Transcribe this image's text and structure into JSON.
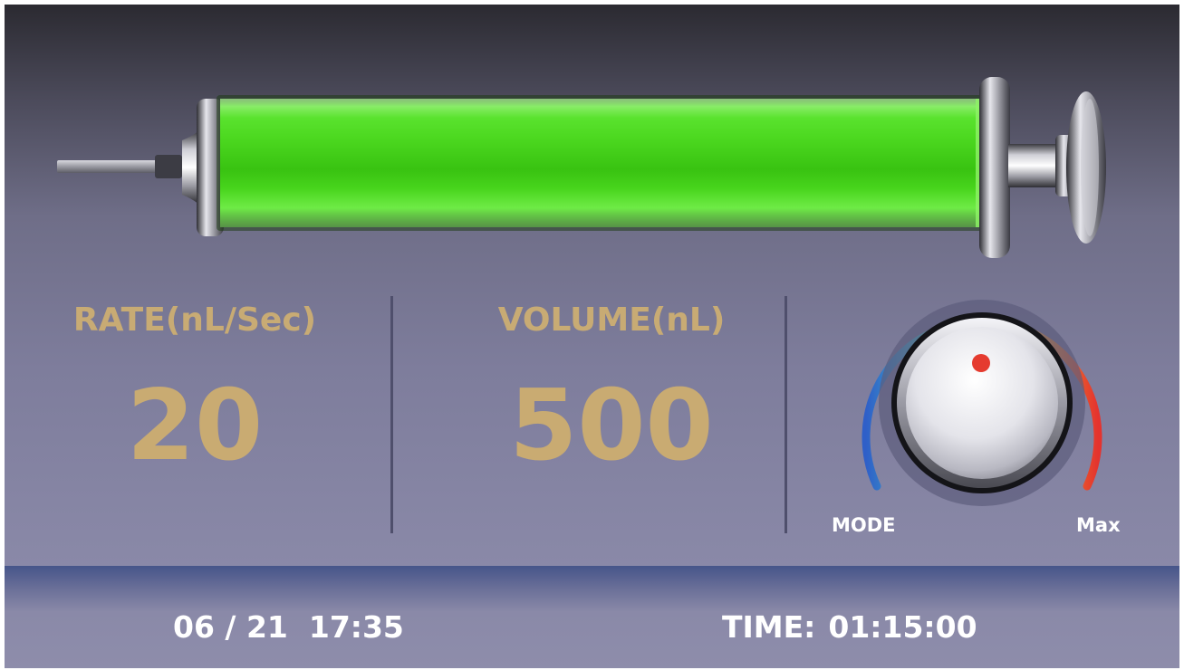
{
  "syringe": {
    "fill_level": 1.0,
    "fill_color": "#43e619"
  },
  "rate": {
    "label": "RATE(nL/Sec)",
    "value": "20"
  },
  "volume": {
    "label": "VOLUME(nL)",
    "value": "500"
  },
  "knob": {
    "mode_label": "MODE",
    "max_label": "Max",
    "indicator_color": "#e53b2f",
    "arc_colors": [
      "#2f5fc8",
      "#3fb8c8",
      "#8fd04a",
      "#f2c63a",
      "#f08a2a",
      "#e4332e"
    ]
  },
  "footer": {
    "datetime": "06 / 21  17:35",
    "time_label": "TIME:",
    "time_value": "01:15:00"
  },
  "colors": {
    "label_gold": "#c8ab74",
    "background": "#7e7d9c"
  }
}
